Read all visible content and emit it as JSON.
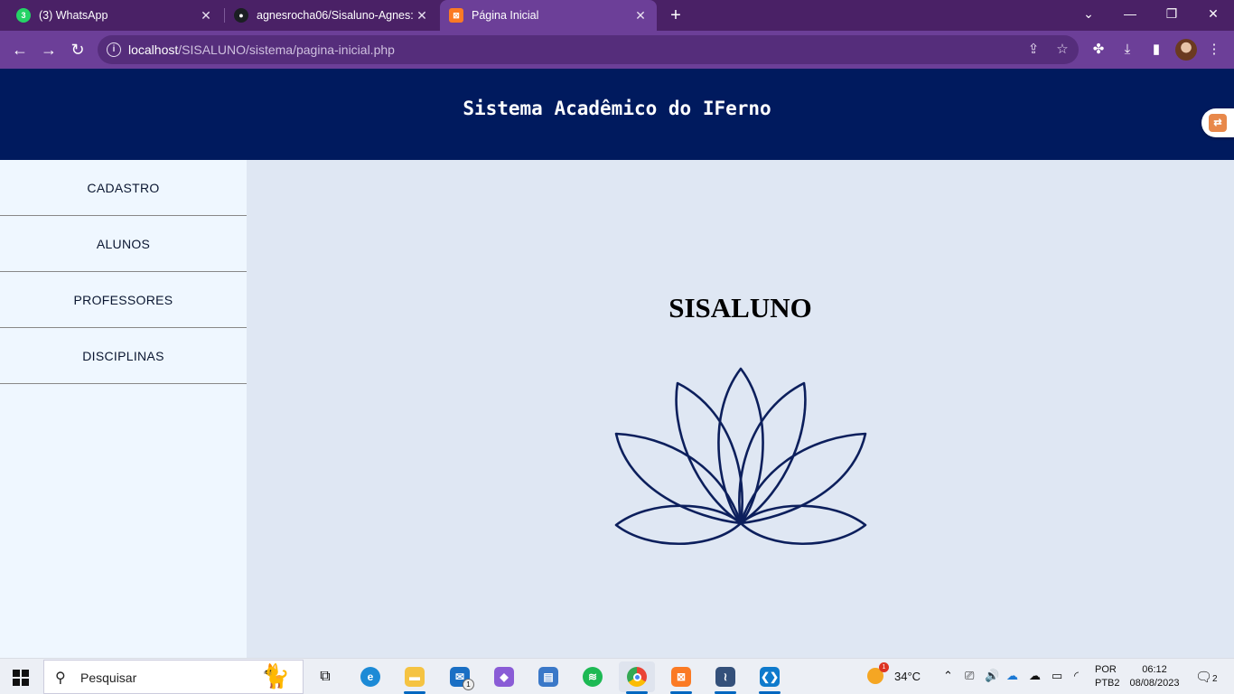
{
  "browser": {
    "tabs": [
      {
        "title": "(3) WhatsApp",
        "favicon": "whatsapp-icon",
        "color": "#25d366",
        "glyph": "3"
      },
      {
        "title": "agnesrocha06/Sisaluno-Agnes: R",
        "favicon": "github-icon",
        "color": "#1b1f23",
        "glyph": ""
      },
      {
        "title": "Página Inicial",
        "favicon": "xampp-icon",
        "color": "#fb7a24",
        "glyph": "⊠"
      }
    ],
    "address": {
      "host": "localhost",
      "path": "/SISALUNO/sistema/pagina-inicial.php"
    }
  },
  "site": {
    "title": "Sistema Acadêmico do IFerno",
    "menu": [
      {
        "label": "CADASTRO"
      },
      {
        "label": "ALUNOS"
      },
      {
        "label": "PROFESSORES"
      },
      {
        "label": "DISCIPLINAS"
      }
    ],
    "brand": "SISALUNO",
    "logo_icon": "lotus-flower-icon",
    "accent_color": "#001a5e",
    "content_background": "#dfe7f3",
    "sidebar_background": "#eff7ff"
  },
  "taskbar": {
    "search_placeholder": "Pesquisar",
    "weather": "34°C",
    "lang_line1": "POR",
    "lang_line2": "PTB2",
    "time": "06:12",
    "date": "08/08/2023",
    "mail_badge": "1",
    "notifications": "2"
  }
}
